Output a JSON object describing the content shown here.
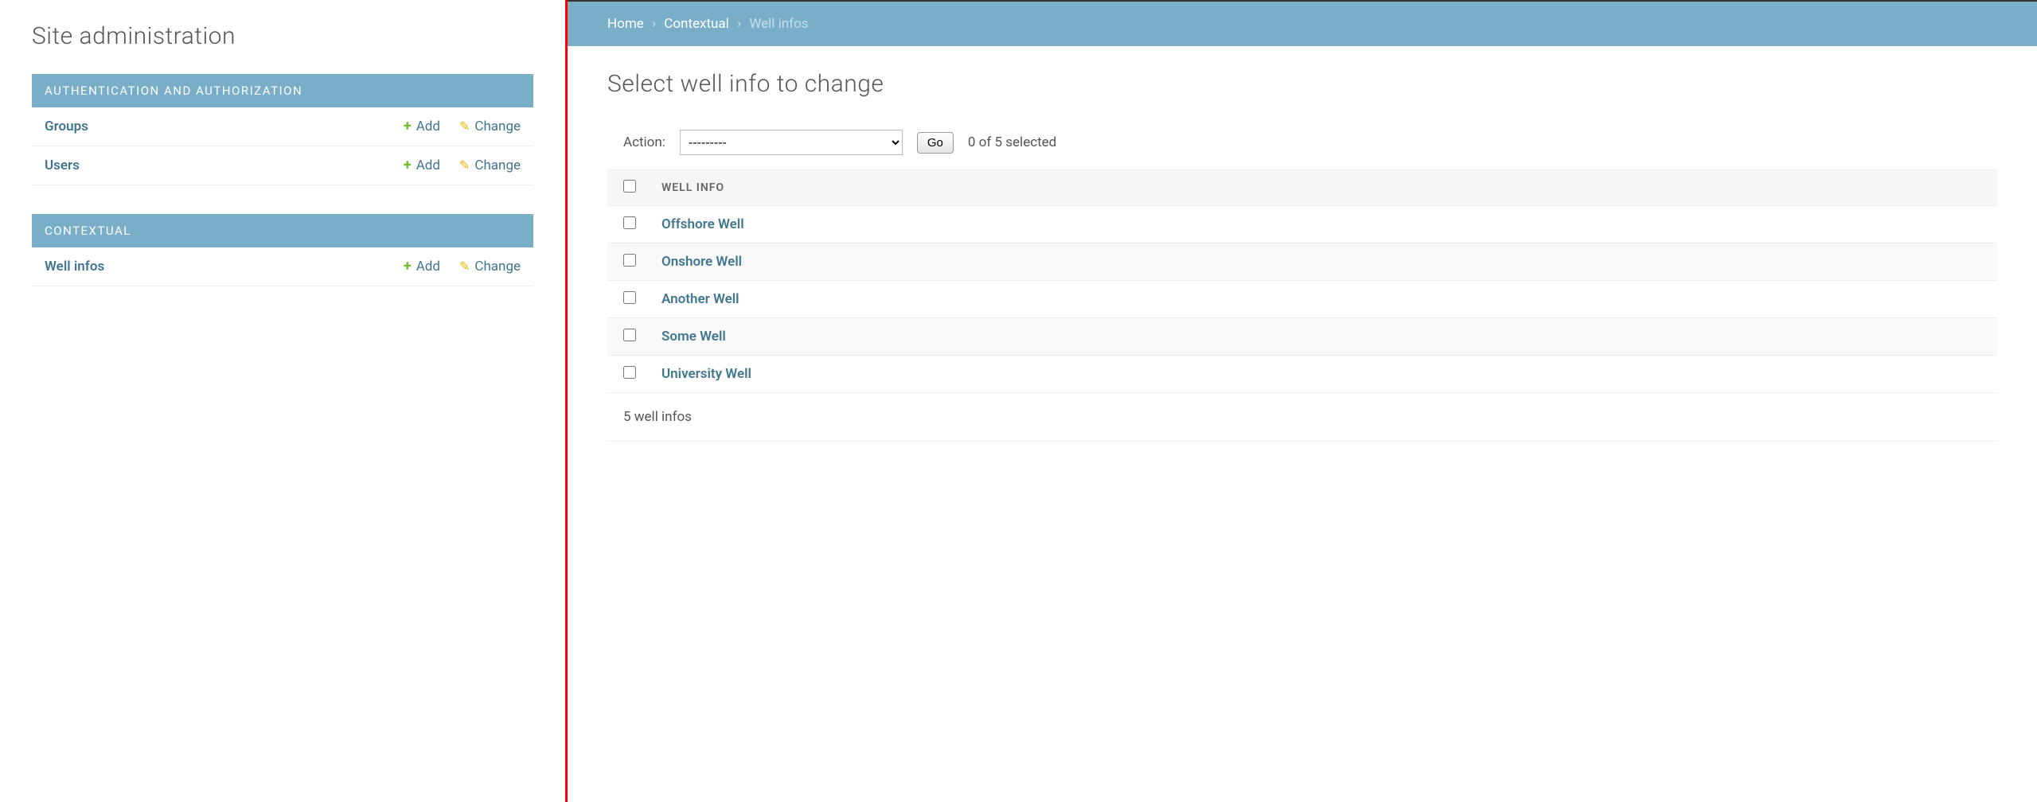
{
  "left": {
    "page_title": "Site administration",
    "modules": [
      {
        "header": "AUTHENTICATION AND AUTHORIZATION",
        "rows": [
          {
            "name": "Groups",
            "add_label": "Add",
            "change_label": "Change"
          },
          {
            "name": "Users",
            "add_label": "Add",
            "change_label": "Change"
          }
        ]
      },
      {
        "header": "CONTEXTUAL",
        "rows": [
          {
            "name": "Well infos",
            "add_label": "Add",
            "change_label": "Change"
          }
        ]
      }
    ]
  },
  "right": {
    "breadcrumb": {
      "home": "Home",
      "section": "Contextual",
      "current": "Well infos"
    },
    "page_title": "Select well info to change",
    "actions": {
      "label": "Action:",
      "placeholder": "---------",
      "go_label": "Go",
      "selection_counter": "0 of 5 selected"
    },
    "table": {
      "column_header": "WELL INFO",
      "rows": [
        {
          "name": "Offshore Well"
        },
        {
          "name": "Onshore Well"
        },
        {
          "name": "Another Well"
        },
        {
          "name": "Some Well"
        },
        {
          "name": "University Well"
        }
      ]
    },
    "footer_count": "5 well infos"
  }
}
